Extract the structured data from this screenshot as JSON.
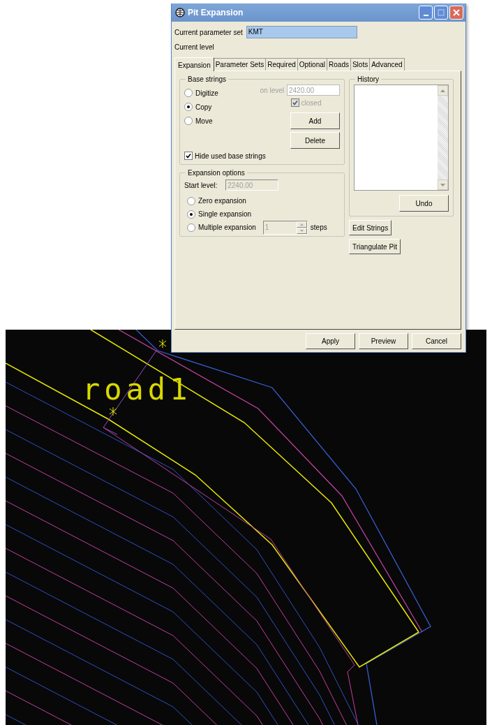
{
  "window": {
    "title": "Pit Expansion"
  },
  "parameter_set": {
    "label": "Current parameter set",
    "value": "KMT"
  },
  "current_level": {
    "label": "Current level"
  },
  "tabs": [
    {
      "label": "Expansion",
      "selected": true
    },
    {
      "label": "Parameter Sets",
      "selected": false
    },
    {
      "label": "Required",
      "selected": false
    },
    {
      "label": "Optional",
      "selected": false
    },
    {
      "label": "Roads",
      "selected": false
    },
    {
      "label": "Slots",
      "selected": false
    },
    {
      "label": "Advanced",
      "selected": false
    }
  ],
  "base_strings": {
    "title": "Base strings",
    "modes": [
      {
        "label": "Digitize",
        "selected": false
      },
      {
        "label": "Copy",
        "selected": true
      },
      {
        "label": "Move",
        "selected": false
      }
    ],
    "on_level": {
      "label": "on level",
      "value": "2420.00",
      "disabled": true
    },
    "closed": {
      "label": "closed",
      "checked": true,
      "disabled": true
    },
    "buttons": [
      "Add",
      "Delete"
    ],
    "hide_used": {
      "label": "Hide used base strings",
      "checked": true
    }
  },
  "expansion_options": {
    "title": "Expansion options",
    "start_level": {
      "label": "Start level:",
      "value": "2240.00",
      "disabled": true
    },
    "modes": [
      {
        "label": "Zero expansion",
        "selected": false
      },
      {
        "label": "Single expansion",
        "selected": true
      },
      {
        "label": "Multiple expansion",
        "selected": false
      }
    ],
    "steps": {
      "value": "1",
      "label": "steps",
      "disabled": true
    }
  },
  "history": {
    "title": "History",
    "button": "Undo"
  },
  "side_buttons": [
    "Edit Strings",
    "Triangulate Pit"
  ],
  "footer_buttons": [
    "Apply",
    "Preview",
    "Cancel"
  ],
  "canvas": {
    "label": "road1"
  }
}
